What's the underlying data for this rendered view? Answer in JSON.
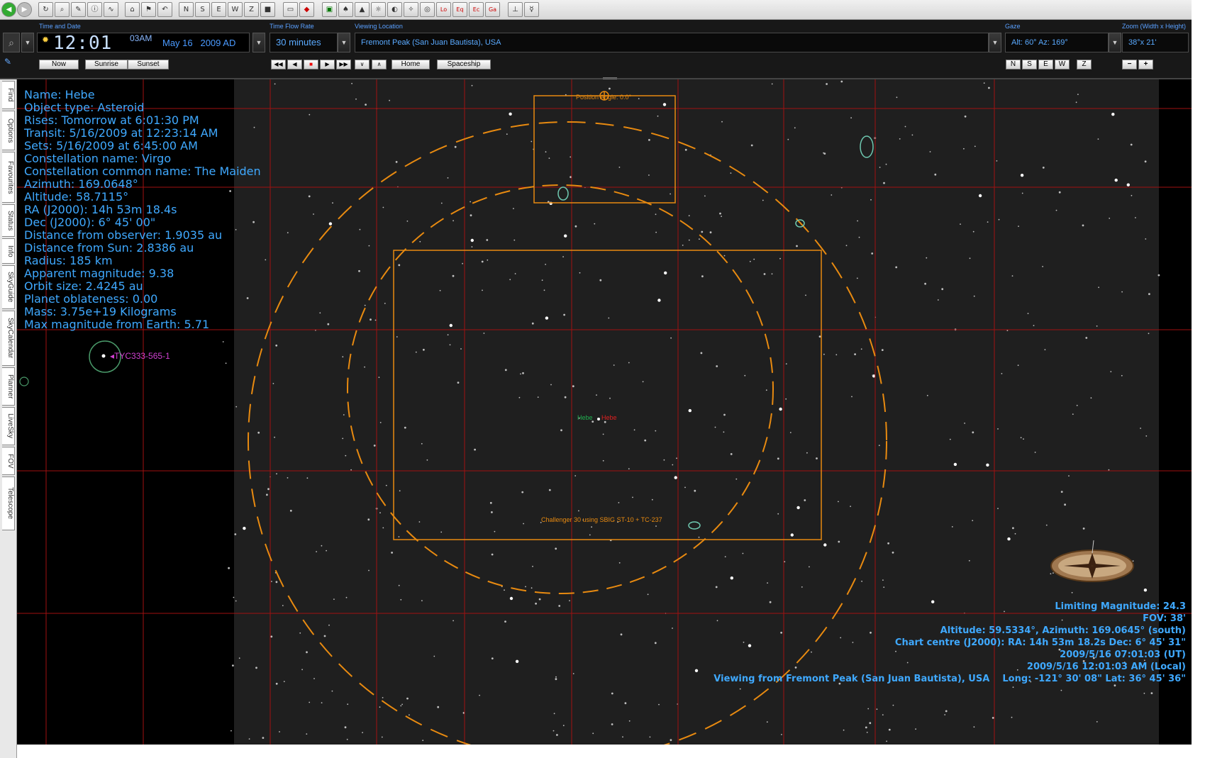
{
  "control": {
    "captions": {
      "time_date": "Time and Date",
      "time_flow": "Time Flow Rate",
      "viewing_location": "Viewing Location",
      "gaze": "Gaze",
      "zoom": "Zoom (Width x Height)"
    },
    "time": "12:01",
    "ampm": "03AM",
    "date": "May 16   2009 AD",
    "time_flow_rate": "30 minutes",
    "location": "Fremont Peak (San Juan Bautista), USA",
    "gaze": "Alt: 60° Az: 169°",
    "zoom": "38°x 21'",
    "buttons": {
      "now": "Now",
      "sunrise": "Sunrise",
      "sunset": "Sunset",
      "home": "Home",
      "spaceship": "Spaceship",
      "n": "N",
      "s": "S",
      "e": "E",
      "w": "W",
      "z": "Z",
      "zoom_out": "−",
      "zoom_in": "+"
    }
  },
  "side_tabs": [
    "Find",
    "Options",
    "Favourites",
    "Status",
    "Info",
    "SkyGuide",
    "SkyCalendar",
    "Planner",
    "LiveSky",
    "FOV",
    "Telescope"
  ],
  "object_info": [
    "Name: Hebe",
    "Object type: Asteroid",
    "Rises: Tomorrow at 6:01:30 PM",
    "Transit: 5/16/2009 at 12:23:14 AM",
    "Sets: 5/16/2009 at 6:45:00 AM",
    "Constellation name: Virgo",
    "Constellation common name: The Maiden",
    "Azimuth: 169.0648°",
    "Altitude: 58.7115°",
    "RA (J2000): 14h 53m 18.4s",
    "Dec (J2000): 6° 45' 00\"",
    "Distance from observer: 1.9035 au",
    "Distance from Sun: 2.8386 au",
    "Radius: 185 km",
    "Apparent magnitude: 9.38",
    "Orbit size: 2.4245 au",
    "Planet oblateness: 0.00",
    "Mass: 3.75e+19 Kilograms",
    "Max magnitude from Earth: 5.71"
  ],
  "chart_labels": {
    "star_label": "TYC333-565-1",
    "position_angle": "Position Angle: 0.0°",
    "fov_caption": "Challenger 30 using SBIG ST-10 + TC-237",
    "hebe_left": "Hebe",
    "hebe_right": "Hebe"
  },
  "status": {
    "limiting_magnitude": "Limiting Magnitude: 24.3",
    "fov": "FOV: 38'",
    "altaz": "Altitude: 59.5334°, Azimuth: 169.0645° (south)",
    "chart_centre": "Chart centre (J2000): RA: 14h 53m 18.2s Dec: 6° 45' 31\"",
    "ut": "2009/5/16 07:01:03 (UT)",
    "local": "2009/5/16 12:01:03 AM (Local)",
    "viewing_from": "Viewing from Fremont Peak (San Juan Bautista), USA    Long: -121° 30' 08\" Lat: 36° 45' 36\""
  },
  "colors": {
    "info_text": "#3fa9ff",
    "fov_orange": "#e88a10",
    "grid_red": "#a01010",
    "star_label_magenta": "#d040d0",
    "hebe_green": "#20b050",
    "hebe_red": "#e02020"
  }
}
